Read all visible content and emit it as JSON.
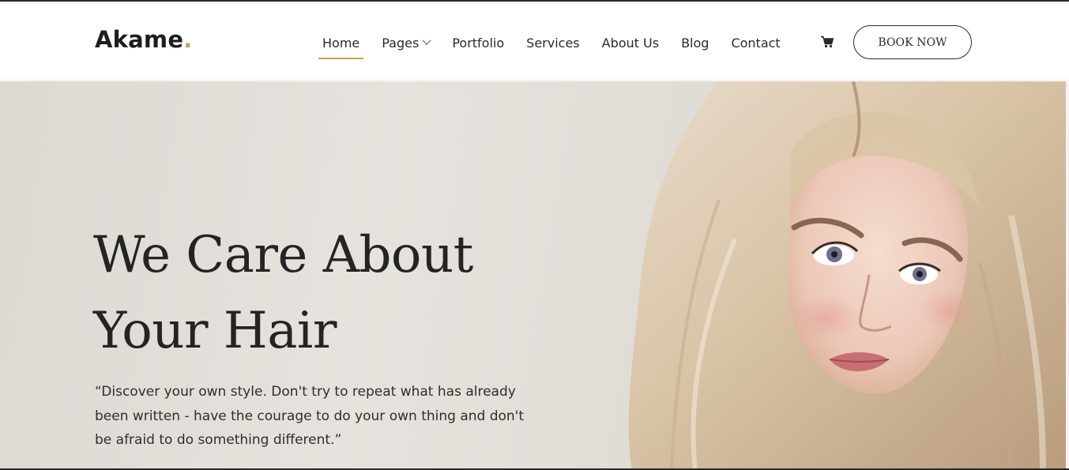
{
  "brand": {
    "name": "Akame",
    "dot": ".",
    "accent_color": "#c4a24a"
  },
  "nav": {
    "items": [
      {
        "label": "Home",
        "active": true
      },
      {
        "label": "Pages",
        "has_dropdown": true
      },
      {
        "label": "Portfolio"
      },
      {
        "label": "Services"
      },
      {
        "label": "About Us"
      },
      {
        "label": "Blog"
      },
      {
        "label": "Contact"
      }
    ],
    "cart_icon": "cart-icon",
    "dropdown_icon": "chevron-down-icon"
  },
  "cta": {
    "book_label": "BOOK NOW"
  },
  "hero": {
    "title_line1": "We Care About",
    "title_line2": "Your Hair",
    "quote": "“Discover your own style. Don't try to repeat what has already been written - have the courage to do your own thing and don't be afraid to do something different.”",
    "image": "portrait-photo"
  }
}
